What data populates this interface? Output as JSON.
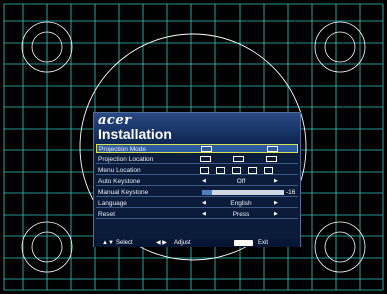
{
  "brand": "acer",
  "title": "Installation",
  "colors": {
    "grid": "#37c7c2",
    "circle": "#ffffff",
    "panel": "#0a1c3a",
    "highlight": "#d8e24e"
  },
  "menu": [
    {
      "label": "Projection Mode",
      "value": "",
      "type": "icons-mode"
    },
    {
      "label": "Projection Location",
      "value": "",
      "type": "icons-location"
    },
    {
      "label": "Menu Location",
      "value": "",
      "type": "icons-menu"
    },
    {
      "label": "Auto Keystone",
      "value": "Off",
      "type": "select"
    },
    {
      "label": "Manual Keystone",
      "value": "-16",
      "type": "slider",
      "level": 0.12
    },
    {
      "label": "Language",
      "value": "English",
      "type": "select"
    },
    {
      "label": "Reset",
      "value": "Press",
      "type": "select"
    }
  ],
  "footer": {
    "select": "Select",
    "adjust": "Adjust",
    "menu_key": "MENU",
    "exit": "Exit"
  }
}
